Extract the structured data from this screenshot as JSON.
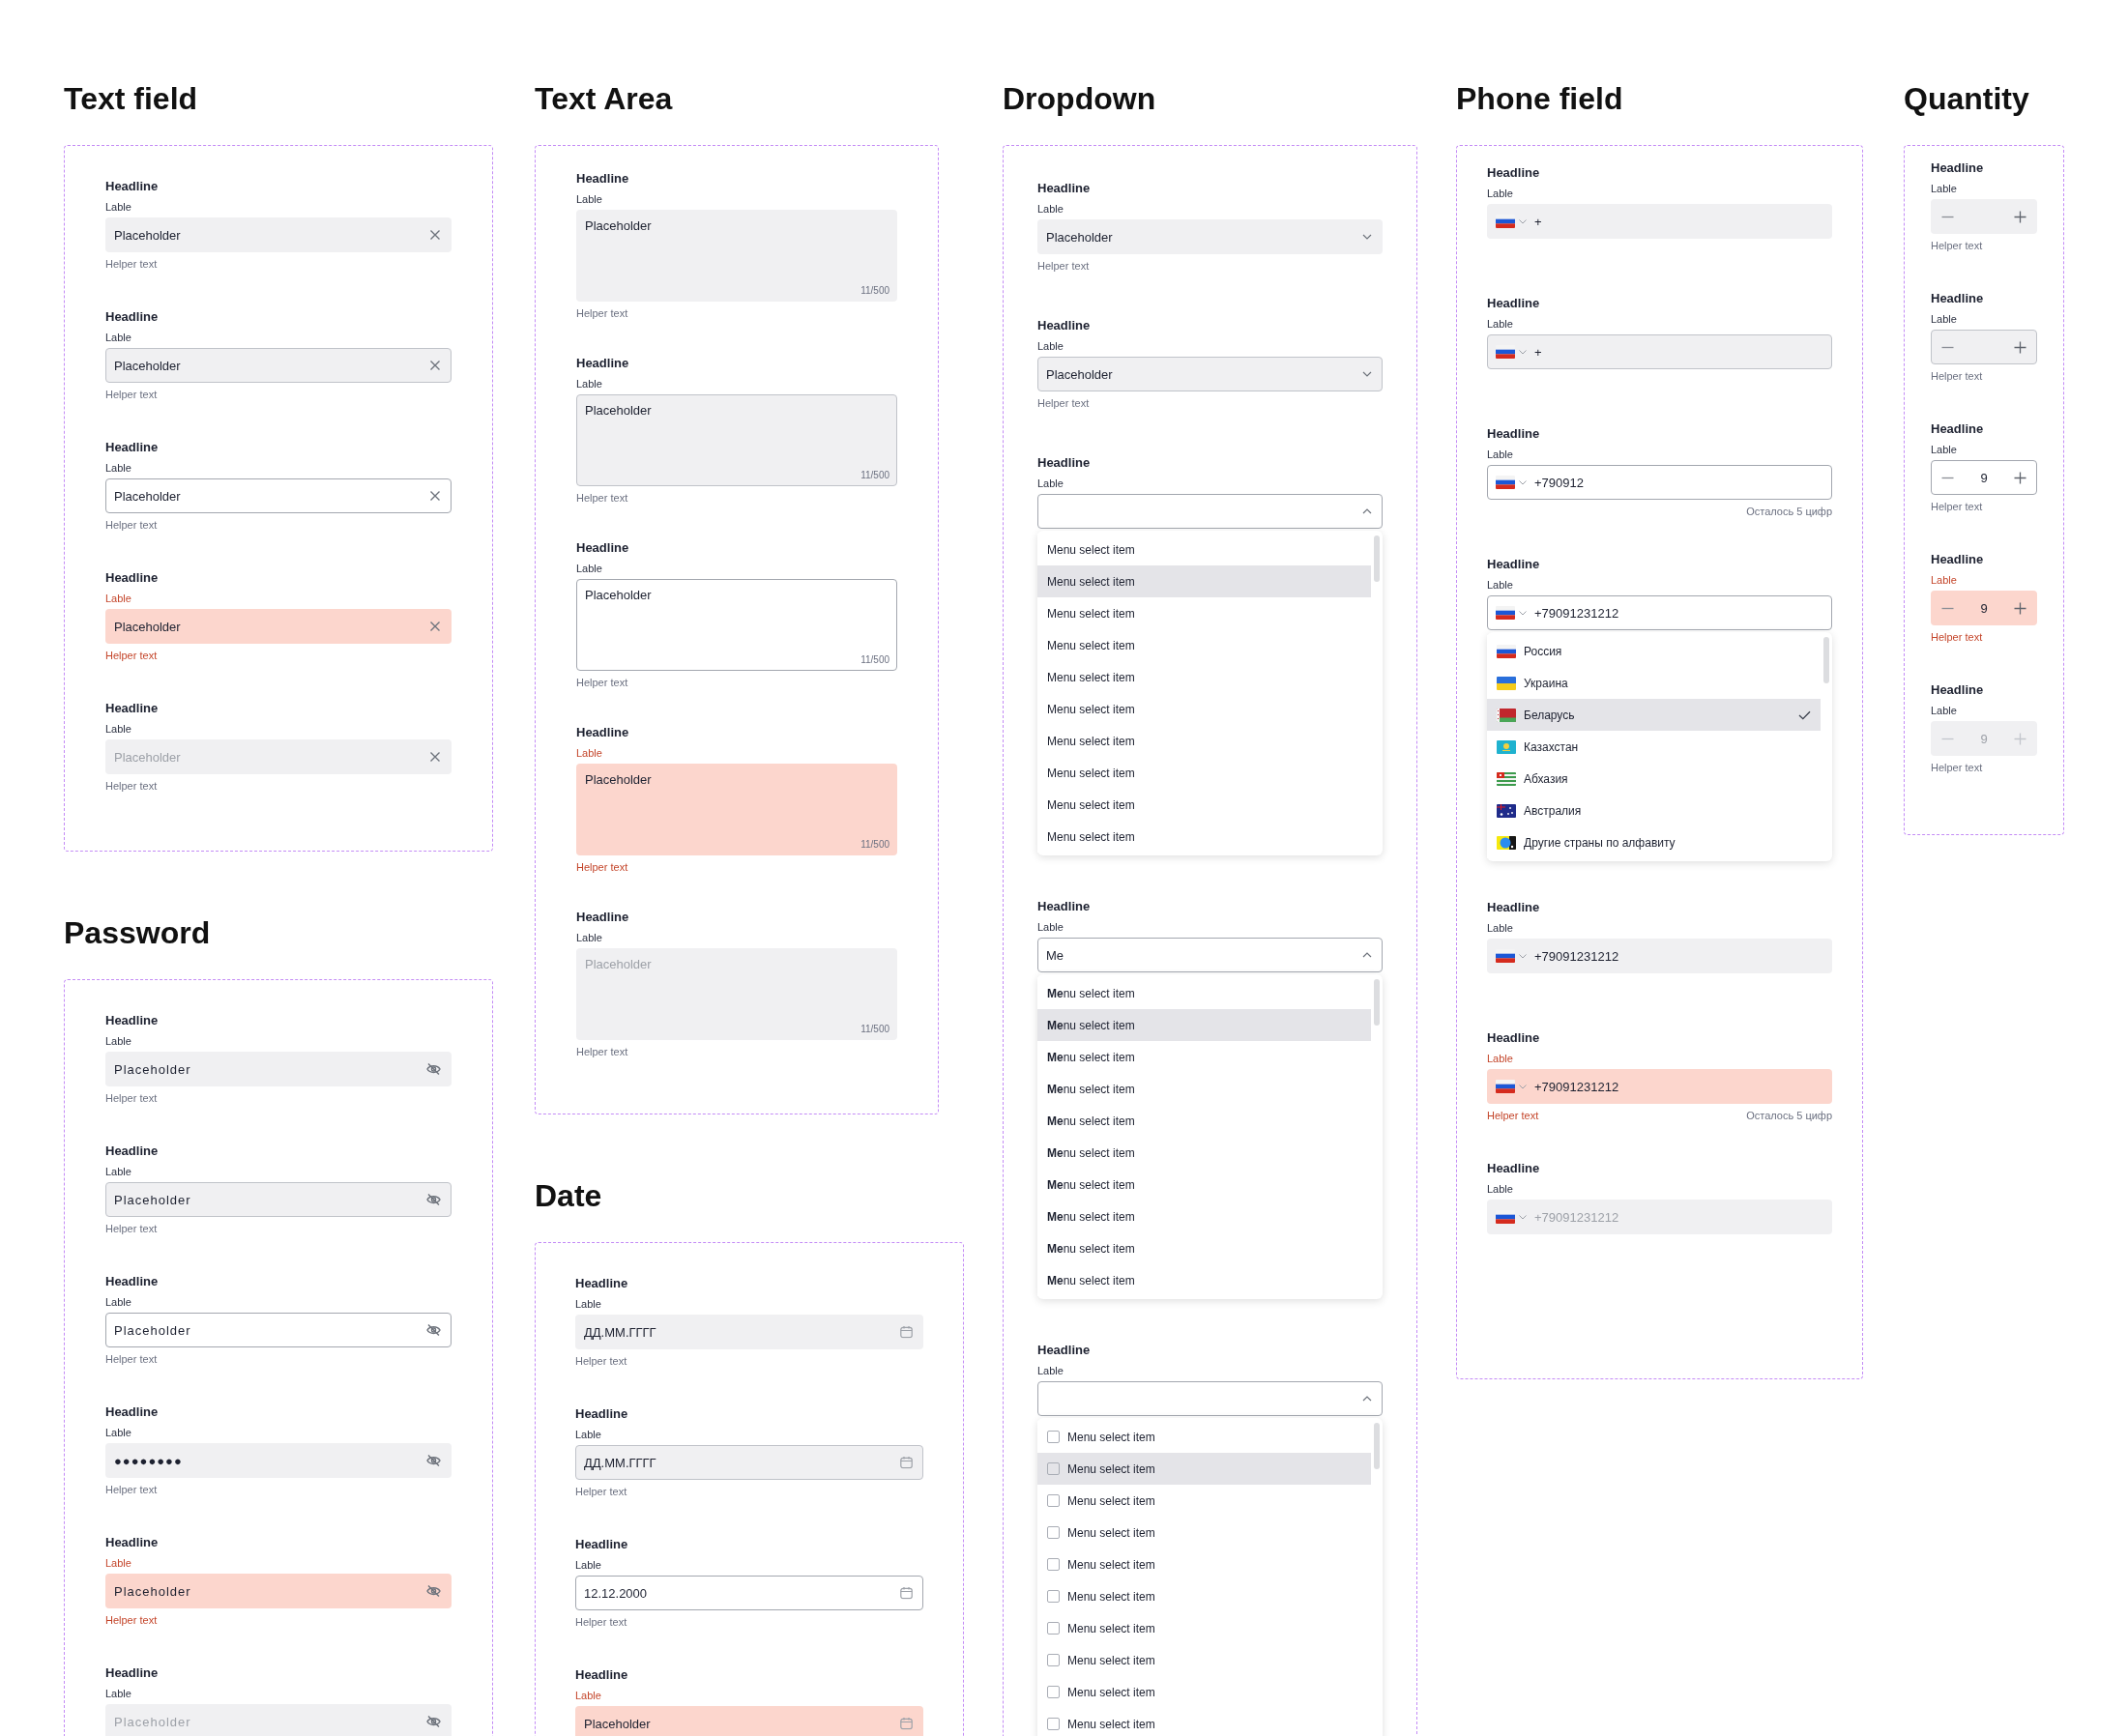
{
  "columns": [
    {
      "sections": [
        {
          "kind": "text",
          "title": "Text field",
          "fields": [
            {
              "headline": "Headline",
              "label": "Lable",
              "hovered": false,
              "focused": false,
              "error": false,
              "disabled": false,
              "placeholder": "Placeholder",
              "helper": "Helper text"
            },
            {
              "headline": "Headline",
              "label": "Lable",
              "hovered": true,
              "focused": false,
              "error": false,
              "disabled": false,
              "placeholder": "Placeholder",
              "helper": "Helper text"
            },
            {
              "headline": "Headline",
              "label": "Lable",
              "hovered": false,
              "focused": true,
              "error": false,
              "disabled": false,
              "placeholder": "Placeholder",
              "helper": "Helper text"
            },
            {
              "headline": "Headline",
              "label": "Lable",
              "hovered": false,
              "focused": false,
              "error": true,
              "disabled": false,
              "placeholder": "Placeholder",
              "helper": "Helper text"
            },
            {
              "headline": "Headline",
              "label": "Lable",
              "hovered": false,
              "focused": false,
              "error": false,
              "disabled": true,
              "placeholder": "Placeholder",
              "helper": "Helper text"
            }
          ]
        },
        {
          "kind": "password",
          "title": "Password",
          "fields": [
            {
              "headline": "Headline",
              "label": "Lable",
              "hovered": false,
              "focused": false,
              "error": false,
              "disabled": false,
              "placeholder": "Placeholder",
              "helper": "Helper text"
            },
            {
              "headline": "Headline",
              "label": "Lable",
              "hovered": true,
              "focused": false,
              "error": false,
              "disabled": false,
              "placeholder": "Placeholder",
              "helper": "Helper text"
            },
            {
              "headline": "Headline",
              "label": "Lable",
              "hovered": false,
              "focused": true,
              "error": false,
              "disabled": false,
              "placeholder": "Placeholder",
              "helper": "Helper text"
            },
            {
              "headline": "Headline",
              "label": "Lable",
              "hovered": false,
              "focused": false,
              "error": false,
              "disabled": false,
              "value": "●●●●●●●●",
              "helper": "Helper text"
            },
            {
              "headline": "Headline",
              "label": "Lable",
              "hovered": false,
              "focused": false,
              "error": true,
              "disabled": false,
              "placeholder": "Placeholder",
              "helper": "Helper text"
            },
            {
              "headline": "Headline",
              "label": "Lable",
              "hovered": false,
              "focused": false,
              "error": false,
              "disabled": true,
              "placeholder": "Placeholder"
            }
          ]
        }
      ]
    },
    {
      "sections": [
        {
          "kind": "textarea",
          "title": "Text Area",
          "fields": [
            {
              "headline": "Headline",
              "label": "Lable",
              "hovered": false,
              "focused": false,
              "error": false,
              "disabled": false,
              "placeholder": "Placeholder",
              "counter": "11/500",
              "helper": "Helper text"
            },
            {
              "headline": "Headline",
              "label": "Lable",
              "hovered": true,
              "focused": false,
              "error": false,
              "disabled": false,
              "placeholder": "Placeholder",
              "counter": "11/500",
              "helper": "Helper text"
            },
            {
              "headline": "Headline",
              "label": "Lable",
              "hovered": false,
              "focused": true,
              "error": false,
              "disabled": false,
              "placeholder": "Placeholder",
              "counter": "11/500",
              "helper": "Helper text"
            },
            {
              "headline": "Headline",
              "label": "Lable",
              "hovered": false,
              "focused": false,
              "error": true,
              "disabled": false,
              "placeholder": "Placeholder",
              "counter": "11/500",
              "helper": "Helper text"
            },
            {
              "headline": "Headline",
              "label": "Lable",
              "hovered": false,
              "focused": false,
              "error": false,
              "disabled": true,
              "placeholder": "Placeholder",
              "counter": "11/500",
              "helper": "Helper text"
            }
          ]
        },
        {
          "kind": "date",
          "title": "Date",
          "fields": [
            {
              "headline": "Headline",
              "label": "Lable",
              "hovered": false,
              "focused": false,
              "error": false,
              "disabled": false,
              "placeholder": "ДД.ММ.ГГГГ",
              "helper": "Helper text"
            },
            {
              "headline": "Headline",
              "label": "Lable",
              "hovered": true,
              "focused": false,
              "error": false,
              "disabled": false,
              "placeholder": "ДД.ММ.ГГГГ",
              "helper": "Helper text"
            },
            {
              "headline": "Headline",
              "label": "Lable",
              "hovered": false,
              "focused": true,
              "error": false,
              "disabled": false,
              "value": "12.12.2000",
              "helper": "Helper text"
            },
            {
              "headline": "Headline",
              "label": "Lable",
              "hovered": false,
              "focused": false,
              "error": true,
              "disabled": false,
              "placeholder": "Placeholder"
            }
          ]
        }
      ]
    },
    {
      "sections": [
        {
          "kind": "dropdown",
          "title": "Dropdown",
          "fields": [
            {
              "headline": "Headline",
              "label": "Lable",
              "hovered": false,
              "focused": false,
              "error": false,
              "disabled": false,
              "expanded": false,
              "placeholder": "Placeholder",
              "helper": "Helper text"
            },
            {
              "headline": "Headline",
              "label": "Lable",
              "hovered": true,
              "focused": false,
              "error": false,
              "disabled": false,
              "expanded": false,
              "placeholder": "Placeholder",
              "helper": "Helper text"
            },
            {
              "headline": "Headline",
              "label": "Lable",
              "hovered": false,
              "focused": true,
              "error": false,
              "disabled": false,
              "expanded": true,
              "menu": {
                "kind": "plain",
                "items": [
                  {
                    "label": "Menu select item",
                    "highlighted": false
                  },
                  {
                    "label": "Menu select item",
                    "highlighted": true
                  },
                  {
                    "label": "Menu select item",
                    "highlighted": false
                  },
                  {
                    "label": "Menu select item",
                    "highlighted": false
                  },
                  {
                    "label": "Menu select item",
                    "highlighted": false
                  },
                  {
                    "label": "Menu select item",
                    "highlighted": false
                  },
                  {
                    "label": "Menu select item",
                    "highlighted": false
                  },
                  {
                    "label": "Menu select item",
                    "highlighted": false
                  },
                  {
                    "label": "Menu select item",
                    "highlighted": false
                  },
                  {
                    "label": "Menu select item",
                    "highlighted": false
                  }
                ]
              }
            },
            {
              "headline": "Headline",
              "label": "Lable",
              "hovered": false,
              "focused": true,
              "error": false,
              "disabled": false,
              "expanded": true,
              "value": "Me",
              "menu": {
                "kind": "plain",
                "items": [
                  {
                    "label": "**Me**nu select item",
                    "highlighted": false
                  },
                  {
                    "label": "**Me**nu select item",
                    "highlighted": true
                  },
                  {
                    "label": "**Me**nu select item",
                    "highlighted": false
                  },
                  {
                    "label": "**Me**nu select item",
                    "highlighted": false
                  },
                  {
                    "label": "**Me**nu select item",
                    "highlighted": false
                  },
                  {
                    "label": "**Me**nu select item",
                    "highlighted": false
                  },
                  {
                    "label": "**Me**nu select item",
                    "highlighted": false
                  },
                  {
                    "label": "**Me**nu select item",
                    "highlighted": false
                  },
                  {
                    "label": "**Me**nu select item",
                    "highlighted": false
                  },
                  {
                    "label": "**Me**nu select item",
                    "highlighted": false
                  }
                ]
              }
            },
            {
              "headline": "Headline",
              "label": "Lable",
              "hovered": false,
              "focused": true,
              "error": false,
              "disabled": false,
              "expanded": true,
              "menu": {
                "kind": "checkbox",
                "items": [
                  {
                    "label": "Menu select item",
                    "highlighted": false,
                    "checked": false
                  },
                  {
                    "label": "Menu select item",
                    "highlighted": true,
                    "checked": false
                  },
                  {
                    "label": "Menu select item",
                    "highlighted": false,
                    "checked": false
                  },
                  {
                    "label": "Menu select item",
                    "highlighted": false,
                    "checked": false
                  },
                  {
                    "label": "Menu select item",
                    "highlighted": false,
                    "checked": false
                  },
                  {
                    "label": "Menu select item",
                    "highlighted": false,
                    "checked": false
                  },
                  {
                    "label": "Menu select item",
                    "highlighted": false,
                    "checked": false
                  },
                  {
                    "label": "Menu select item",
                    "highlighted": false,
                    "checked": false
                  },
                  {
                    "label": "Menu select item",
                    "highlighted": false,
                    "checked": false
                  },
                  {
                    "label": "Menu select item",
                    "highlighted": false,
                    "checked": false
                  }
                ]
              }
            }
          ]
        }
      ]
    },
    {
      "sections": [
        {
          "kind": "phone",
          "title": "Phone field",
          "fields": [
            {
              "headline": "Headline",
              "label": "Lable",
              "hovered": false,
              "focused": false,
              "error": false,
              "disabled": false,
              "value": "+"
            },
            {
              "headline": "Headline",
              "label": "Lable",
              "hovered": true,
              "focused": false,
              "error": false,
              "disabled": false,
              "value": "+"
            },
            {
              "headline": "Headline",
              "label": "Lable",
              "hovered": false,
              "focused": true,
              "error": false,
              "disabled": false,
              "value": "+790912",
              "counter": "Осталось 5 цифр"
            },
            {
              "headline": "Headline",
              "label": "Lable",
              "hovered": false,
              "focused": true,
              "error": false,
              "disabled": false,
              "value": "+79091231212",
              "menu": {
                "kind": "country",
                "items": [
                  {
                    "label": "Россия",
                    "kind": "ru",
                    "selected": false
                  },
                  {
                    "label": "Украина",
                    "kind": "ua",
                    "selected": false
                  },
                  {
                    "label": "Беларусь",
                    "kind": "by",
                    "selected": true
                  },
                  {
                    "label": "Казахстан",
                    "kind": "kz",
                    "selected": false
                  },
                  {
                    "label": "Абхазия",
                    "kind": "ab",
                    "selected": false
                  },
                  {
                    "label": "Австралия",
                    "kind": "au",
                    "selected": false
                  },
                  {
                    "label": "Другие страны по алфавиту",
                    "kind": "other",
                    "selected": false
                  }
                ]
              }
            },
            {
              "headline": "Headline",
              "label": "Lable",
              "hovered": false,
              "focused": false,
              "error": false,
              "disabled": false,
              "value": "+79091231212"
            },
            {
              "headline": "Headline",
              "label": "Lable",
              "hovered": false,
              "focused": false,
              "error": true,
              "disabled": false,
              "value": "+79091231212",
              "helper": "Helper text",
              "counter": "Осталось 5 цифр"
            },
            {
              "headline": "Headline",
              "label": "Lable",
              "hovered": false,
              "focused": false,
              "error": false,
              "disabled": true,
              "value": "+79091231212"
            }
          ]
        }
      ]
    },
    {
      "sections": [
        {
          "kind": "quantity",
          "title": "Quantity",
          "fields": [
            {
              "headline": "Headline",
              "label": "Lable",
              "hovered": false,
              "focused": false,
              "error": false,
              "disabled": false,
              "helper": "Helper text"
            },
            {
              "headline": "Headline",
              "label": "Lable",
              "hovered": true,
              "focused": false,
              "error": false,
              "disabled": false,
              "helper": "Helper text"
            },
            {
              "headline": "Headline",
              "label": "Lable",
              "hovered": false,
              "focused": true,
              "error": false,
              "disabled": false,
              "value": "9",
              "helper": "Helper text"
            },
            {
              "headline": "Headline",
              "label": "Lable",
              "hovered": false,
              "focused": false,
              "error": true,
              "disabled": false,
              "value": "9",
              "helper": "Helper text"
            },
            {
              "headline": "Headline",
              "label": "Lable",
              "hovered": false,
              "focused": false,
              "error": false,
              "disabled": true,
              "value": "9",
              "helper": "Helper text"
            }
          ]
        }
      ]
    }
  ]
}
